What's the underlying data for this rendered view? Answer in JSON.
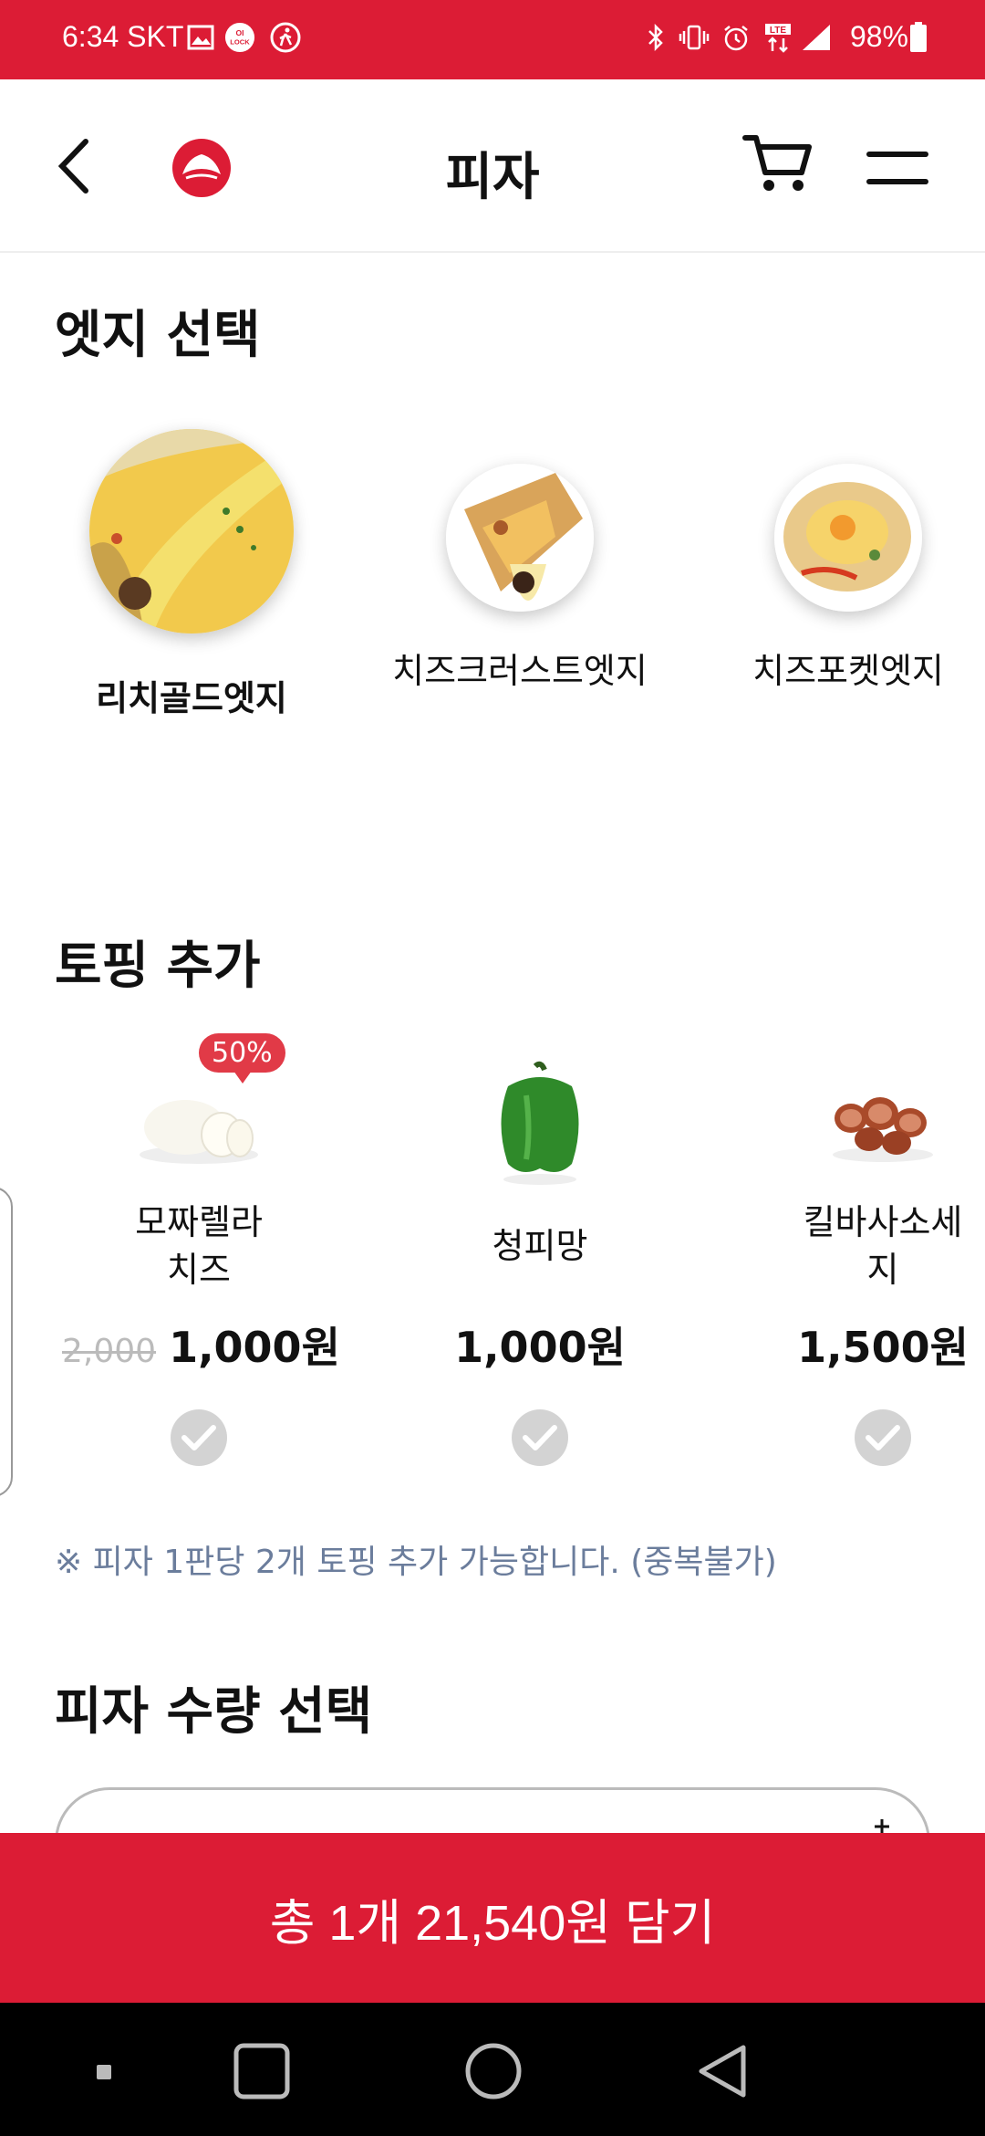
{
  "status_bar": {
    "time": "6:34 SKT",
    "battery": "98%"
  },
  "header": {
    "title": "피자"
  },
  "edge_section": {
    "title": "엣지 선택",
    "items": [
      {
        "label": "리치골드엣지",
        "selected": true
      },
      {
        "label": "치즈크러스트엣지",
        "selected": false
      },
      {
        "label": "치즈포켓엣지",
        "selected": false
      }
    ]
  },
  "topping_section": {
    "title": "토핑 추가",
    "badge": "50%",
    "items": [
      {
        "name_line1": "모짜렐라",
        "name_line2": "치즈",
        "original_price": "2,000",
        "price": "1,000원"
      },
      {
        "name_line1": "청피망",
        "name_line2": "",
        "price": "1,000원"
      },
      {
        "name_line1": "킬바사소세",
        "name_line2": "지",
        "price": "1,500원"
      }
    ],
    "notice": "※ 피자 1판당 2개 토핑 추가 가능합니다. (중복불가)"
  },
  "quantity_section": {
    "title": "피자 수량 선택"
  },
  "cta": {
    "label": "총 1개 21,540원 담기"
  },
  "colors": {
    "brand_red": "#dc1c35",
    "badge_red": "#e13a47",
    "notice_blue_gray": "#6b7d9c"
  }
}
